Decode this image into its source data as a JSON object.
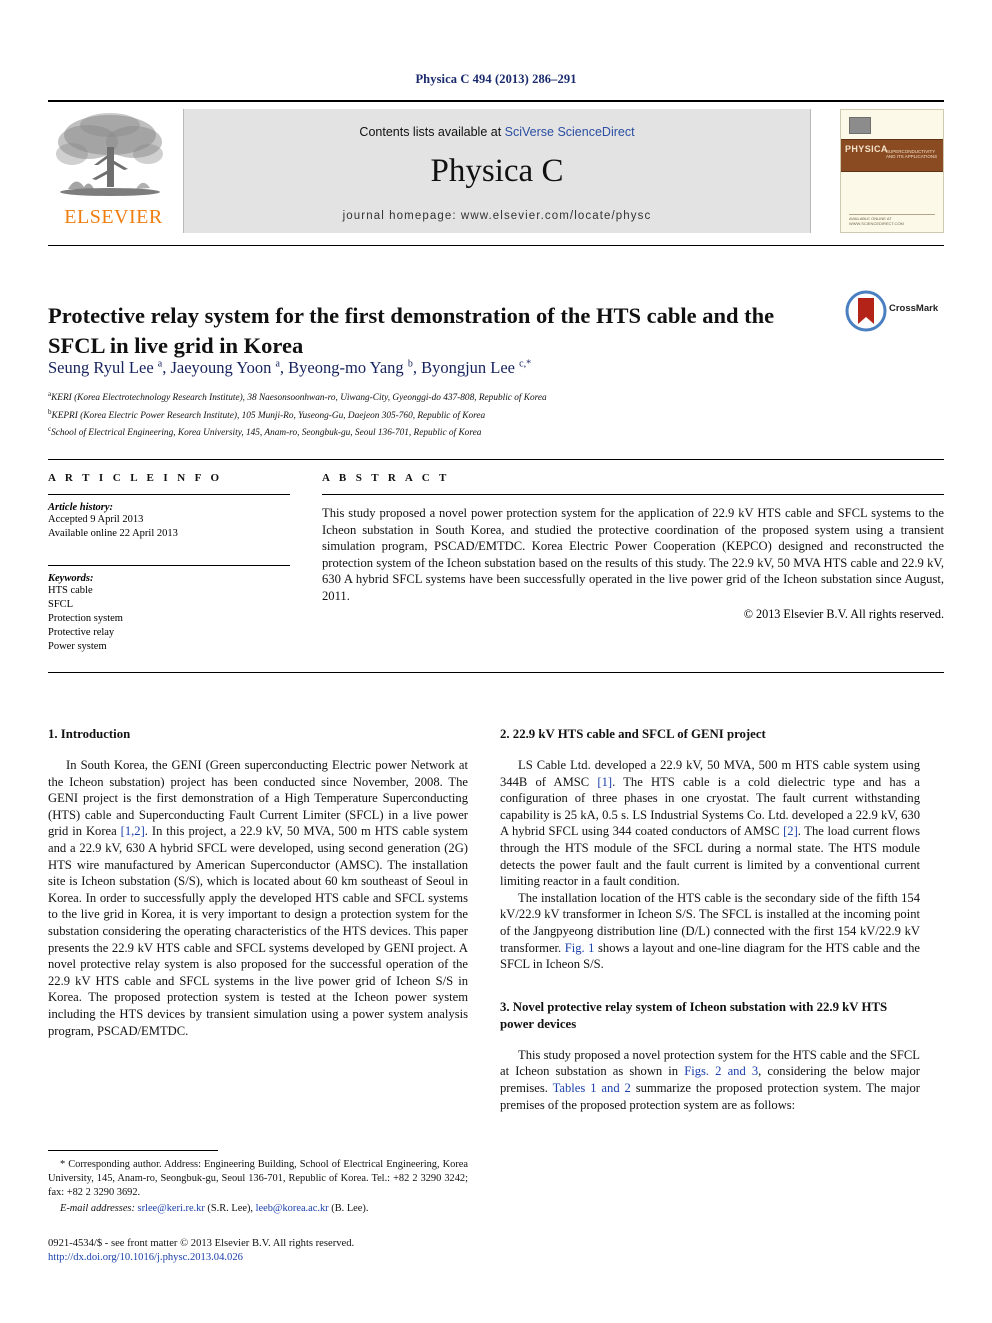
{
  "running_head": "Physica C 494 (2013) 286–291",
  "masthead": {
    "contents_prefix": "Contents lists available at ",
    "sciencedirect": "SciVerse ScienceDirect",
    "journal_name": "Physica C",
    "homepage": "journal homepage: www.elsevier.com/locate/physc",
    "publisher_logo_text": "ELSEVIER",
    "cover": {
      "band_title": "PHYSICA",
      "band_letter": "C",
      "band_subtitle": "SUPERCONDUCTIVITY AND ITS APPLICATIONS",
      "footer_text": "AVAILABLE ONLINE AT WWW.SCIENCEDIRECT.COM"
    }
  },
  "article": {
    "title": "Protective relay system for the first demonstration of the HTS cable and the SFCL in live grid in Korea",
    "crossmark_label": "CrossMark",
    "authors_html": "Seung Ryul Lee <sup>a</sup>, Jaeyoung Yoon <sup>a</sup>, Byeong-mo Yang <sup>b</sup>, Byongjun Lee <sup>c,</sup><sup>*</sup>",
    "affiliations": [
      "KERI (Korea Electrotechnology Research Institute), 38 Naesonsoonhwan-ro, Uiwang-City, Gyeonggi-do 437-808, Republic of Korea",
      "KEPRI (Korea Electric Power Research Institute), 105 Munji-Ro, Yuseong-Gu, Daejeon 305-760, Republic of Korea",
      "School of Electrical Engineering, Korea University, 145, Anam-ro, Seongbuk-gu, Seoul 136-701, Republic of Korea"
    ],
    "affiliation_marks": [
      "a",
      "b",
      "c"
    ]
  },
  "article_info": {
    "heading": "A R T I C L E    I N F O",
    "history_label": "Article history:",
    "history_lines": [
      "Accepted 9 April 2013",
      "Available online 22 April 2013"
    ],
    "keywords_label": "Keywords:",
    "keywords": [
      "HTS cable",
      "SFCL",
      "Protection system",
      "Protective relay",
      "Power system"
    ]
  },
  "abstract": {
    "heading": "A B S T R A C T",
    "text": "This study proposed a novel power protection system for the application of 22.9 kV HTS cable and SFCL systems to the Icheon substation in South Korea, and studied the protective coordination of the proposed system using a transient simulation program, PSCAD/EMTDC. Korea Electric Power Cooperation (KEPCO) designed and reconstructed the protection system of the Icheon substation based on the results of this study. The 22.9 kV, 50 MVA HTS cable and 22.9 kV, 630 A hybrid SFCL systems have been successfully operated in the live power grid of the Icheon substation since August, 2011.",
    "copyright": "© 2013 Elsevier B.V. All rights reserved."
  },
  "sections": {
    "intro": {
      "heading": "1. Introduction",
      "paragraph_pre": "In South Korea, the GENI (Green superconducting Electric power Network at the Icheon substation) project has been conducted since November, 2008. The GENI project is the first demonstration of a High Temperature Superconducting (HTS) cable and Superconducting Fault Current Limiter (SFCL) in a live power grid in Korea ",
      "citation": "[1,2]",
      "paragraph_post": ". In this project, a 22.9 kV, 50 MVA, 500 m HTS cable system and a 22.9 kV, 630 A hybrid SFCL were developed, using second generation (2G) HTS wire manufactured by American Superconductor (AMSC). The installation site is Icheon substation (S/S), which is located about 60 km southeast of Seoul in Korea. In order to successfully apply the developed HTS cable and SFCL systems to the live grid in Korea, it is very important to design a protection system for the substation considering the operating characteristics of the HTS devices. This paper presents the 22.9 kV HTS cable and SFCL systems developed by GENI project. A novel protective relay system is also proposed for the successful operation of the 22.9 kV HTS cable and SFCL systems in the live power grid of Icheon S/S in Korea. The proposed protection system is tested at the Icheon power system including the HTS devices by transient simulation using a power system analysis program, PSCAD/EMTDC."
    },
    "section2": {
      "heading": "2. 22.9 kV HTS cable and SFCL of GENI project",
      "p1_a": "LS Cable Ltd. developed a 22.9 kV, 50 MVA, 500 m HTS cable system using 344B of AMSC ",
      "p1_cite1": "[1]",
      "p1_b": ". The HTS cable is a cold dielectric type and has a configuration of three phases in one cryostat. The fault current withstanding capability is 25 kA, 0.5 s. LS Industrial Systems Co. Ltd. developed a 22.9 kV, 630 A hybrid SFCL using 344 coated conductors of AMSC ",
      "p1_cite2": "[2]",
      "p1_c": ". The load current flows through the HTS module of the SFCL during a normal state. The HTS module detects the power fault and the fault current is limited by a conventional current limiting reactor in a fault condition.",
      "p2_a": "The installation location of the HTS cable is the secondary side of the fifth 154 kV/22.9 kV transformer in Icheon S/S. The SFCL is installed at the incoming point of the Jangpyeong distribution line (D/L) connected with the first 154 kV/22.9 kV transformer. ",
      "p2_cite": "Fig. 1",
      "p2_b": " shows a layout and one-line diagram for the HTS cable and the SFCL in Icheon S/S."
    },
    "section3": {
      "heading": "3. Novel protective relay system of Icheon substation with 22.9 kV HTS power devices",
      "p1_a": "This study proposed a novel protection system for the HTS cable and the SFCL at Icheon substation as shown in ",
      "p1_cite1": "Figs. 2 and 3",
      "p1_b": ", considering the below major premises. ",
      "p1_cite2": "Tables 1 and 2",
      "p1_c": " summarize the proposed protection system. The major premises of the proposed protection system are as follows:"
    }
  },
  "footnotes": {
    "corresponding": "* Corresponding author. Address: Engineering Building, School of Electrical Engineering, Korea University, 145, Anam-ro, Seongbuk-gu, Seoul 136-701, Republic of Korea. Tel.: +82 2 3290 3242; fax: +82 2 3290 3692.",
    "email_label": "E-mail addresses:",
    "email1": "srlee@keri.re.kr",
    "email1_owner": " (S.R. Lee), ",
    "email2": "leeb@korea.ac.kr",
    "email2_owner": " (B. Lee)."
  },
  "imprint": {
    "line1": "0921-4534/$ - see front matter © 2013 Elsevier B.V. All rights reserved.",
    "doi": "http://dx.doi.org/10.1016/j.physc.2013.04.026"
  },
  "colors": {
    "link": "#1a3faa",
    "elsevier_orange": "#ef7d10",
    "running_head": "#1a2a6c",
    "author_navy": "#16225c",
    "banner_gray": "#e3e3e3",
    "crossmark_red": "#b32317",
    "crossmark_blue": "#4a7fc1"
  }
}
